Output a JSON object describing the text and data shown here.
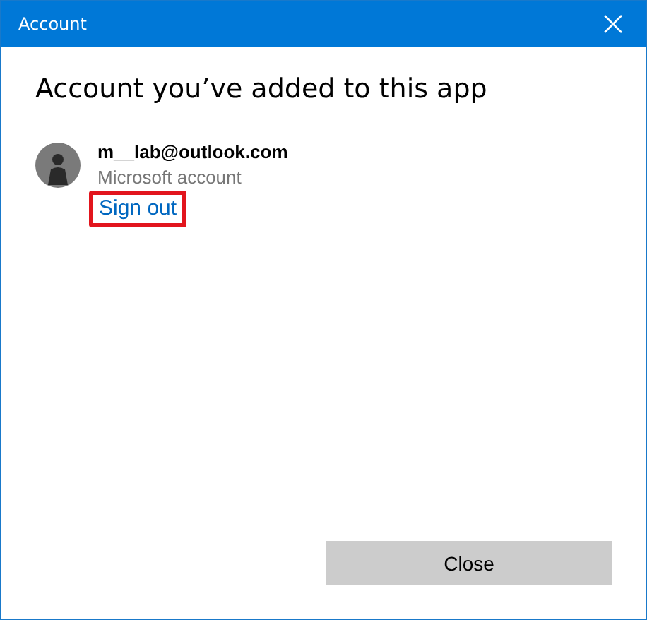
{
  "window": {
    "title": "Account"
  },
  "heading": "Account you’ve added to this app",
  "account": {
    "email": "m__lab@outlook.com",
    "type": "Microsoft account",
    "sign_out": {
      "label": "Sign out",
      "highlighted": true
    }
  },
  "buttons": [
    {
      "label": "Close"
    }
  ]
}
